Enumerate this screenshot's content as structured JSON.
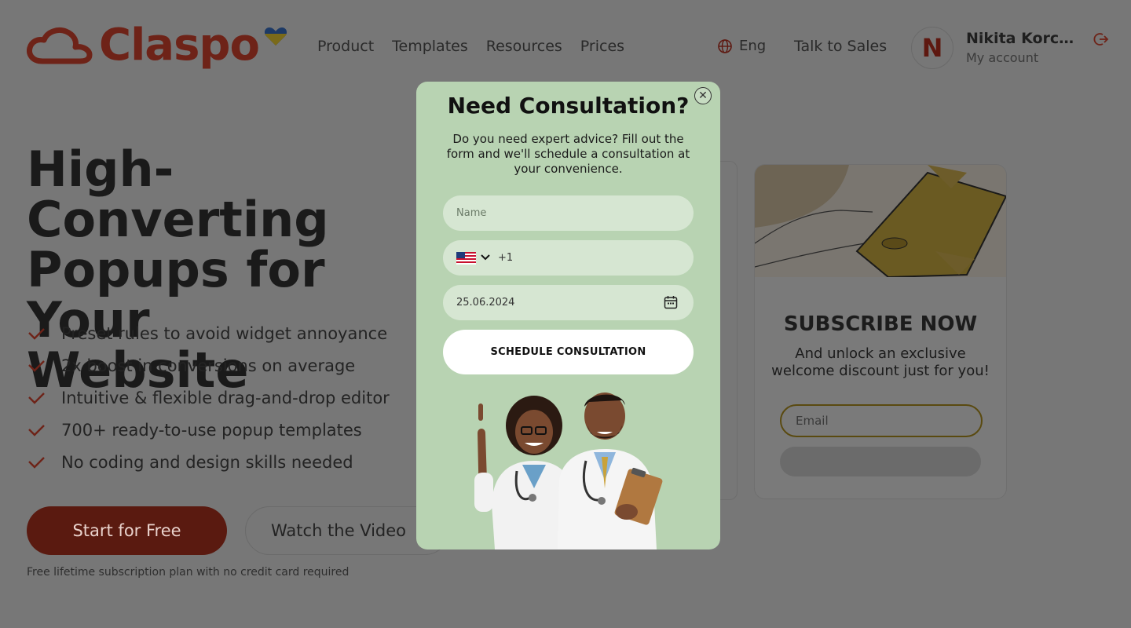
{
  "header": {
    "logo_text": "Claspo",
    "nav": [
      "Product",
      "Templates",
      "Resources",
      "Prices"
    ],
    "language": "Eng",
    "talk_to_sales": "Talk to Sales",
    "avatar_letter": "N",
    "user_name": "Nikita Korche...",
    "user_sub": "My account"
  },
  "hero": {
    "title_lines": [
      "High-Converting",
      "Popups for Your",
      "Website"
    ],
    "features": [
      "Preset rules to avoid widget annoyance",
      "2x boost in conversions on average",
      "Intuitive & flexible drag-and-drop editor",
      "700+ ready-to-use popup templates",
      "No coding and design skills needed"
    ],
    "start_button": "Start for Free",
    "video_button": "Watch the Video",
    "free_note": "Free lifetime subscription plan with no credit card required"
  },
  "subscribe_card": {
    "title": "SUBSCRIBE NOW",
    "text": "And unlock an exclusive welcome discount just for you!",
    "email_placeholder": "Email"
  },
  "modal": {
    "title": "Need Consultation?",
    "description": "Do you need expert advice? Fill out the form and we'll schedule a consultation at your convenience.",
    "name_placeholder": "Name",
    "phone_code": "+1",
    "date_value": "25.06.2024",
    "button": "SCHEDULE CONSULTATION"
  },
  "colors": {
    "overlay_bg": "#777777",
    "brand": "#6e2318",
    "modal_bg": "#b8d3b2"
  }
}
